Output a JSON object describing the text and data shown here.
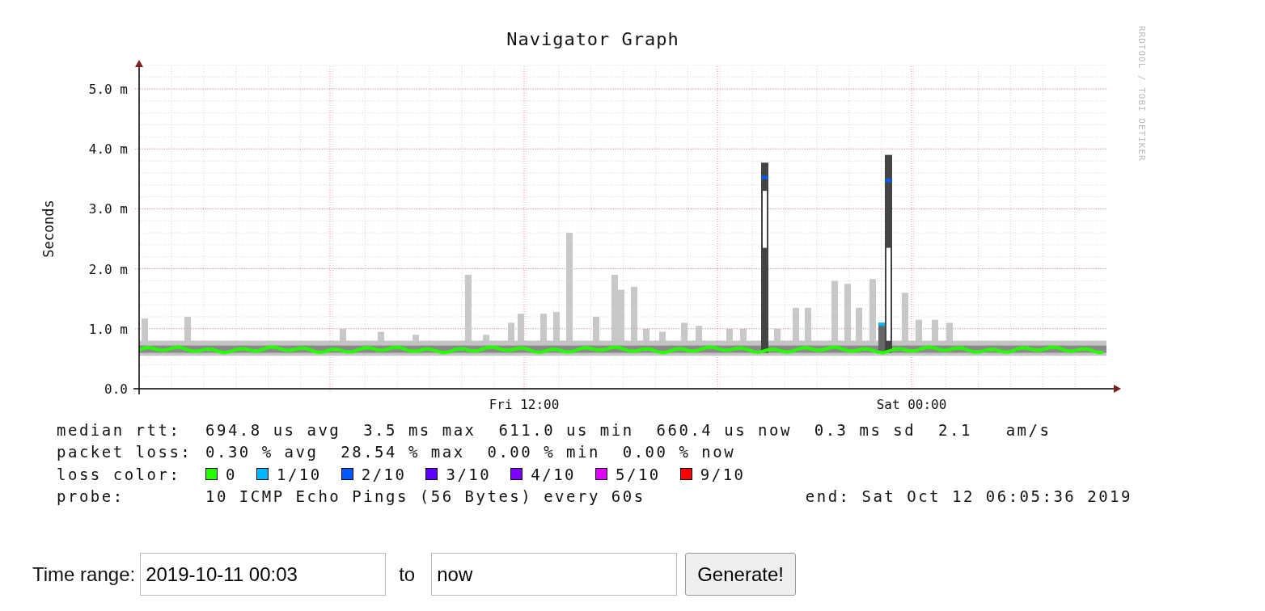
{
  "graph": {
    "title": "Navigator Graph",
    "credit": "RRDTOOL / TOBI OETIKER",
    "y_axis_label": "Seconds",
    "y_ticks": [
      "5.0 m",
      "4.0 m",
      "3.0 m",
      "2.0 m",
      "1.0 m",
      "0.0"
    ],
    "x_ticks": [
      "Fri 12:00",
      "Sat 00:00"
    ]
  },
  "legend": {
    "rows": [
      {
        "label": "median rtt:",
        "text": "694.8 us avg  3.5 ms max  611.0 us min  660.4 us now  0.3 ms sd  2.1   am/s"
      },
      {
        "label": "packet loss:",
        "text": "0.30 % avg  28.54 % max  0.00 % min  0.00 % now"
      }
    ],
    "loss_color": {
      "label": "loss color:",
      "items": [
        {
          "label": "0",
          "color": "#26ff00"
        },
        {
          "label": "1/10",
          "color": "#00b8ff"
        },
        {
          "label": "2/10",
          "color": "#0059ff"
        },
        {
          "label": "3/10",
          "color": "#5e00ff"
        },
        {
          "label": "4/10",
          "color": "#7e00ff"
        },
        {
          "label": "5/10",
          "color": "#dd00ff"
        },
        {
          "label": "9/10",
          "color": "#ff0000"
        }
      ]
    },
    "probe": {
      "label": "probe:",
      "text": "10 ICMP Echo Pings (56 Bytes) every 60s",
      "end": "end: Sat Oct 12 06:05:36 2019"
    }
  },
  "form": {
    "label": "Time range:",
    "from": "2019-10-11 00:03",
    "separator": "to",
    "to": "now",
    "button": "Generate!"
  }
}
